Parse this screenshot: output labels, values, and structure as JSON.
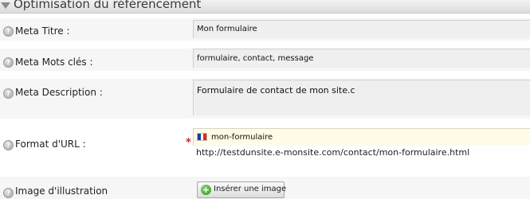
{
  "section": {
    "title": "Optimisation du référencement"
  },
  "help_glyph": "?",
  "fields": {
    "meta_title": {
      "label": "Meta Titre :",
      "value": "Mon formulaire"
    },
    "meta_keywords": {
      "label": "Meta Mots clés :",
      "value": "formulaire, contact, message"
    },
    "meta_description": {
      "label": "Meta Description :",
      "value": "Formulaire de contact de mon site.c"
    },
    "url_format": {
      "label": "Format d'URL :",
      "required_mark": "*",
      "value": "mon-formulaire",
      "preview": "http://testdunsite.e-monsite.com/contact/mon-formulaire.html"
    },
    "illustration": {
      "label": "Image d'illustration",
      "button_label": "Insérer une image"
    }
  },
  "icons": {
    "collapse": "triangle-down-icon",
    "help": "help-icon",
    "flag": "france-flag-icon",
    "add": "plus-icon"
  },
  "colors": {
    "required": "#d91e18",
    "url_field_bg": "#fffbe6",
    "add_icon": "#3aa52a",
    "flag": [
      "#1f3d99",
      "#ffffff",
      "#e1261c"
    ]
  }
}
